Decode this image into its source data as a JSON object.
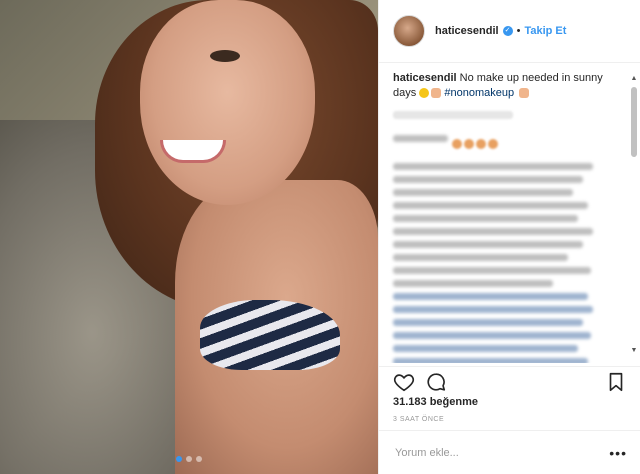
{
  "header": {
    "username": "haticesendil",
    "separator": "•",
    "follow_label": "Takip Et"
  },
  "caption": {
    "username": "haticesendil",
    "text": "No make up needed in sunny days",
    "hashtag": "#nonomakeup"
  },
  "engagement": {
    "likes": "31.183 beğenme",
    "time": "3 SAAT ÖNCE"
  },
  "comment_box": {
    "placeholder": "Yorum ekle...",
    "more_label": "•••"
  },
  "carousel": {
    "active_index": 0,
    "count": 3
  },
  "colors": {
    "link_blue": "#3897f0",
    "hashtag": "#003569"
  },
  "icons": {
    "like": "heart-icon",
    "comment": "comment-icon",
    "save": "bookmark-icon",
    "verified": "verified-badge-icon"
  }
}
